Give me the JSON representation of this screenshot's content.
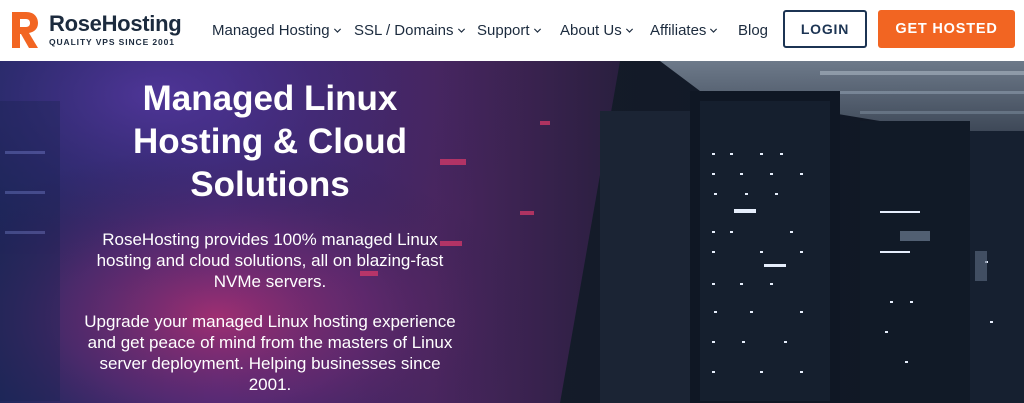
{
  "brand": {
    "name": "RoseHosting",
    "tagline": "QUALITY VPS SINCE 2001",
    "accent": "#f26522",
    "navy": "#1c3453"
  },
  "nav": {
    "items": [
      {
        "label": "Managed Hosting",
        "dropdown": true
      },
      {
        "label": "SSL / Domains",
        "dropdown": true
      },
      {
        "label": "Support",
        "dropdown": true
      },
      {
        "label": "About Us",
        "dropdown": true
      },
      {
        "label": "Affiliates",
        "dropdown": true
      },
      {
        "label": "Blog",
        "dropdown": false
      }
    ],
    "login_label": "LOGIN",
    "cta_label": "GET HOSTED"
  },
  "hero": {
    "title_lines": [
      "Managed Linux",
      "Hosting & Cloud",
      "Solutions"
    ],
    "paragraph_1_lines": [
      "RoseHosting provides 100% managed Linux",
      "hosting and cloud solutions, all on blazing-fast",
      "NVMe servers."
    ],
    "paragraph_2_lines": [
      "Upgrade your managed Linux hosting experience",
      "and get peace of mind from the masters of Linux",
      "server deployment. Helping businesses since",
      "2001."
    ],
    "background_icon": "server-room-photo"
  }
}
